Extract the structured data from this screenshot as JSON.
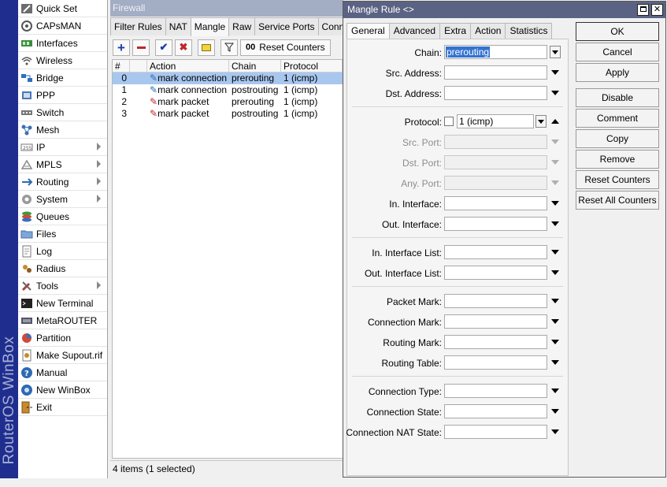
{
  "app": {
    "brand": "RouterOS WinBox"
  },
  "sidebar": {
    "items": [
      {
        "label": "Quick Set",
        "icon": "quick-set-icon",
        "arrow": false
      },
      {
        "label": "CAPsMAN",
        "icon": "capsman-icon",
        "arrow": false
      },
      {
        "label": "Interfaces",
        "icon": "interfaces-icon",
        "arrow": false
      },
      {
        "label": "Wireless",
        "icon": "wireless-icon",
        "arrow": false
      },
      {
        "label": "Bridge",
        "icon": "bridge-icon",
        "arrow": false
      },
      {
        "label": "PPP",
        "icon": "ppp-icon",
        "arrow": false
      },
      {
        "label": "Switch",
        "icon": "switch-icon",
        "arrow": false
      },
      {
        "label": "Mesh",
        "icon": "mesh-icon",
        "arrow": false
      },
      {
        "label": "IP",
        "icon": "ip-icon",
        "arrow": true
      },
      {
        "label": "MPLS",
        "icon": "mpls-icon",
        "arrow": true
      },
      {
        "label": "Routing",
        "icon": "routing-icon",
        "arrow": true
      },
      {
        "label": "System",
        "icon": "system-icon",
        "arrow": true
      },
      {
        "label": "Queues",
        "icon": "queues-icon",
        "arrow": false
      },
      {
        "label": "Files",
        "icon": "files-icon",
        "arrow": false
      },
      {
        "label": "Log",
        "icon": "log-icon",
        "arrow": false
      },
      {
        "label": "Radius",
        "icon": "radius-icon",
        "arrow": false
      },
      {
        "label": "Tools",
        "icon": "tools-icon",
        "arrow": true
      },
      {
        "label": "New Terminal",
        "icon": "terminal-icon",
        "arrow": false
      },
      {
        "label": "MetaROUTER",
        "icon": "metarouter-icon",
        "arrow": false
      },
      {
        "label": "Partition",
        "icon": "partition-icon",
        "arrow": false
      },
      {
        "label": "Make Supout.rif",
        "icon": "supout-icon",
        "arrow": false
      },
      {
        "label": "Manual",
        "icon": "manual-icon",
        "arrow": false
      },
      {
        "label": "New WinBox",
        "icon": "winbox-icon",
        "arrow": false
      },
      {
        "label": "Exit",
        "icon": "exit-icon",
        "arrow": false
      }
    ]
  },
  "firewall": {
    "title": "Firewall",
    "tabs": [
      "Filter Rules",
      "NAT",
      "Mangle",
      "Raw",
      "Service Ports",
      "Connec"
    ],
    "active_tab": "Mangle",
    "toolbar": {
      "reset_counters": "Reset Counters",
      "oo": "00"
    },
    "columns": [
      "#",
      "",
      "Action",
      "Chain",
      "Protocol"
    ],
    "rows": [
      {
        "num": "0",
        "action": "mark connection",
        "chain": "prerouting",
        "protocol": "1 (icmp)",
        "selected": true
      },
      {
        "num": "1",
        "action": "mark connection",
        "chain": "postrouting",
        "protocol": "1 (icmp)",
        "selected": false
      },
      {
        "num": "2",
        "action": "mark packet",
        "chain": "prerouting",
        "protocol": "1 (icmp)",
        "selected": false
      },
      {
        "num": "3",
        "action": "mark packet",
        "chain": "postrouting",
        "protocol": "1 (icmp)",
        "selected": false
      }
    ],
    "status": "4 items (1 selected)"
  },
  "dialog": {
    "title": "Mangle Rule <>",
    "tabs": [
      "General",
      "Advanced",
      "Extra",
      "Action",
      "Statistics"
    ],
    "active_tab": "General",
    "fields": {
      "chain": {
        "label": "Chain:",
        "value": "prerouting"
      },
      "src_address": {
        "label": "Src. Address:",
        "value": ""
      },
      "dst_address": {
        "label": "Dst. Address:",
        "value": ""
      },
      "protocol": {
        "label": "Protocol:",
        "value": "1 (icmp)"
      },
      "src_port": {
        "label": "Src. Port:",
        "value": ""
      },
      "dst_port": {
        "label": "Dst. Port:",
        "value": ""
      },
      "any_port": {
        "label": "Any. Port:",
        "value": ""
      },
      "in_interface": {
        "label": "In. Interface:",
        "value": ""
      },
      "out_interface": {
        "label": "Out. Interface:",
        "value": ""
      },
      "in_interface_list": {
        "label": "In. Interface List:",
        "value": ""
      },
      "out_interface_list": {
        "label": "Out. Interface List:",
        "value": ""
      },
      "packet_mark": {
        "label": "Packet Mark:",
        "value": ""
      },
      "connection_mark": {
        "label": "Connection Mark:",
        "value": ""
      },
      "routing_mark": {
        "label": "Routing Mark:",
        "value": ""
      },
      "routing_table": {
        "label": "Routing Table:",
        "value": ""
      },
      "connection_type": {
        "label": "Connection Type:",
        "value": ""
      },
      "connection_state": {
        "label": "Connection State:",
        "value": ""
      },
      "connection_nat_state": {
        "label": "Connection NAT State:",
        "value": ""
      }
    },
    "buttons": [
      "OK",
      "Cancel",
      "Apply",
      "Disable",
      "Comment",
      "Copy",
      "Remove",
      "Reset Counters",
      "Reset All Counters"
    ]
  },
  "colors": {
    "selection": "#a8c7ef",
    "sidebar_strip": "#1f2e8e",
    "dialog_title": "#5b6384"
  }
}
